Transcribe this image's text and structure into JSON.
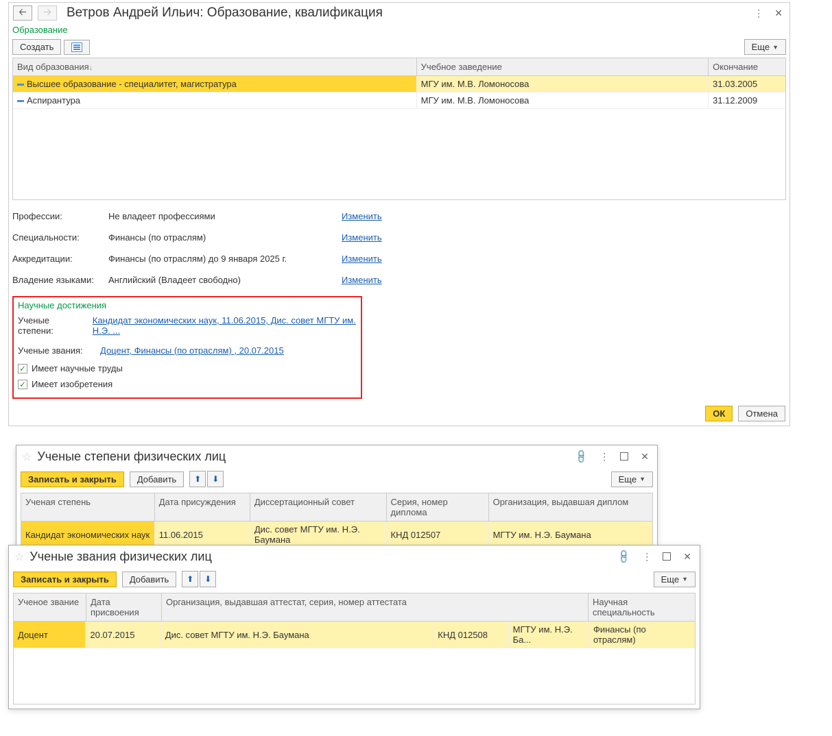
{
  "mainWindow": {
    "title": "Ветров Андрей Ильич: Образование, квалификация",
    "sectionEducation": "Образование",
    "createBtn": "Создать",
    "moreBtn": "Еще",
    "headers": {
      "type": "Вид образования",
      "inst": "Учебное заведение",
      "end": "Окончание"
    },
    "rows": [
      {
        "type": "Высшее образование - специалитет, магистратура",
        "inst": "МГУ им. М.В. Ломоносова",
        "end": "31.03.2005"
      },
      {
        "type": "Аспирантура",
        "inst": "МГУ им. М.В. Ломоносова",
        "end": "31.12.2009"
      }
    ],
    "info": {
      "profLabel": "Профессии:",
      "profValue": "Не владеет профессиями",
      "specLabel": "Специальности:",
      "specValue": "Финансы (по отраслям)",
      "accrLabel": "Аккредитации:",
      "accrValue": "Финансы (по отраслям)  до 9 января 2025 г.",
      "langLabel": "Владение языками:",
      "langValue": "Английский (Владеет свободно)",
      "changeLink": "Изменить"
    },
    "achievements": {
      "title": "Научные достижения",
      "degreeLabel": "Ученые степени:",
      "degreeLink": "Кандидат экономических наук, 11.06.2015, Дис. совет МГТУ им. Н.Э. ...",
      "rankLabel": "Ученые звания:",
      "rankLink": "Доцент, Финансы (по отраслям) , 20.07.2015",
      "hasWorks": "Имеет научные труды",
      "hasInventions": "Имеет изобретения"
    },
    "okBtn": "ОК",
    "cancelBtn": "Отмена"
  },
  "degreeWindow": {
    "title": "Ученые степени физических лиц",
    "saveCloseBtn": "Записать и закрыть",
    "addBtn": "Добавить",
    "moreBtn": "Еще",
    "headers": {
      "a": "Ученая степень",
      "b": "Дата присуждения",
      "c": "Диссертационный совет",
      "d": "Серия, номер диплома",
      "e": "Организация, выдавшая диплом"
    },
    "rows": [
      {
        "a": "Кандидат экономических наук",
        "b": "11.06.2015",
        "c": "Дис. совет МГТУ им. Н.Э. Баумана",
        "d": "КНД 012507",
        "e": "МГТУ им. Н.Э. Баумана"
      }
    ]
  },
  "rankWindow": {
    "title": "Ученые звания физических лиц",
    "saveCloseBtn": "Записать и закрыть",
    "addBtn": "Добавить",
    "moreBtn": "Еще",
    "headers": {
      "a": "Ученое звание",
      "b": "Дата присвоения",
      "c": "Организация, выдавшая аттестат, серия, номер аттестата",
      "f": "Научная специальность"
    },
    "rows": [
      {
        "a": "Доцент",
        "b": "20.07.2015",
        "c": "Дис. совет МГТУ им. Н.Э. Баумана",
        "d": "КНД 012508",
        "e": "МГТУ им. Н.Э. Ба...",
        "f": "Финансы (по отраслям)"
      }
    ]
  }
}
